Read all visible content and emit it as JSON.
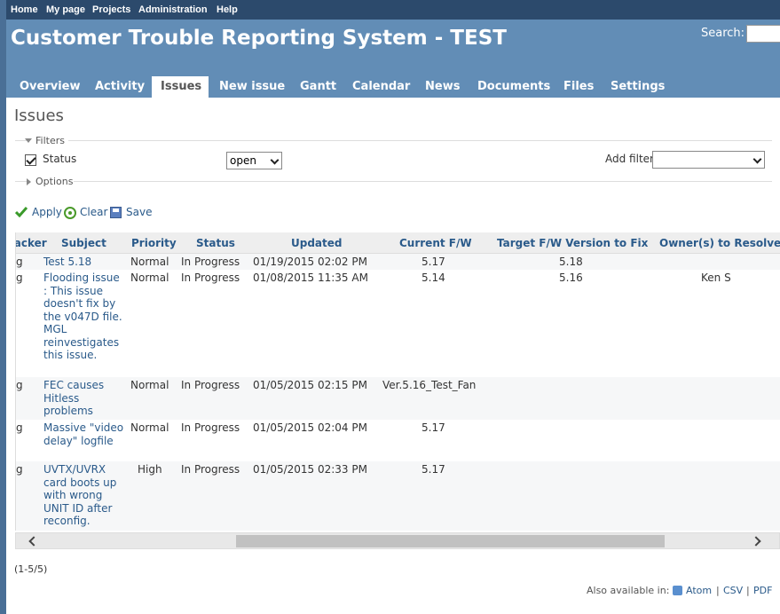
{
  "top_menu": [
    "Home",
    "My page",
    "Projects",
    "Administration",
    "Help"
  ],
  "header": {
    "title": "Customer Trouble Reporting System - TEST",
    "search_label": "Search:",
    "search_value": ""
  },
  "main_menu": [
    "Overview",
    "Activity",
    "Issues",
    "New issue",
    "Gantt",
    "Calendar",
    "News",
    "Documents",
    "Files",
    "Settings"
  ],
  "selected_tab": "Issues",
  "page": {
    "title": "Issues",
    "filters_legend": "Filters",
    "options_legend": "Options",
    "filter_status_label": "Status",
    "filter_status_operator": "open",
    "add_filter_label": "Add filter",
    "add_filter_value": ""
  },
  "actions": {
    "apply": "Apply",
    "clear": "Clear",
    "save": "Save"
  },
  "table": {
    "columns": [
      "Tracker",
      "Subject",
      "Priority",
      "Status",
      "Updated",
      "Current F/W",
      "Target F/W Version to Fix",
      "Owner(s) to Resolve"
    ],
    "rows": [
      {
        "tracker": "g",
        "subject": "Test 5.18",
        "priority": "Normal",
        "status": "In Progress",
        "updated": "01/19/2015 02:02 PM",
        "current_fw": "5.17",
        "target_fw": "5.18",
        "owner": ""
      },
      {
        "tracker": "g",
        "subject": "Flooding issue : This issue doesn't fix by the v047D file. MGL reinvestigates this issue.",
        "priority": "Normal",
        "status": "In Progress",
        "updated": "01/08/2015 11:35 AM",
        "current_fw": "5.14",
        "target_fw": "5.16",
        "owner": "Ken S"
      },
      {
        "tracker": "g",
        "subject": "FEC causes Hitless problems",
        "priority": "Normal",
        "status": "In Progress",
        "updated": "01/05/2015 02:15 PM",
        "current_fw": "Ver.5.16_Test_Fan",
        "target_fw": "",
        "owner": ""
      },
      {
        "tracker": "g",
        "subject": "Massive \"video delay\" logfile",
        "priority": "Normal",
        "status": "In Progress",
        "updated": "01/05/2015 02:04 PM",
        "current_fw": "5.17",
        "target_fw": "",
        "owner": ""
      },
      {
        "tracker": "g",
        "subject": "UVTX/UVRX card boots up with wrong UNIT ID after reconfig.",
        "priority": "High",
        "status": "In Progress",
        "updated": "01/05/2015 02:33 PM",
        "current_fw": "5.17",
        "target_fw": "",
        "owner": ""
      }
    ]
  },
  "pagination": "(1-5/5)",
  "other_formats": {
    "label": "Also available in:",
    "atom": "Atom",
    "csv": "CSV",
    "pdf": "PDF",
    "sep": "|"
  }
}
